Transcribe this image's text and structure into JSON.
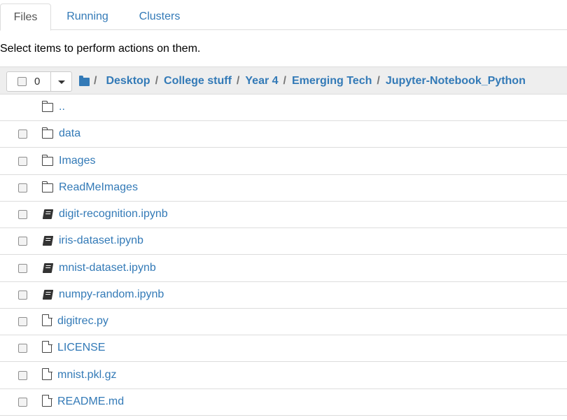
{
  "tabs": {
    "files": "Files",
    "running": "Running",
    "clusters": "Clusters"
  },
  "hint": "Select items to perform actions on them.",
  "toolbar": {
    "selected_count": "0"
  },
  "breadcrumb": {
    "separator": "/",
    "items": [
      "Desktop",
      "College stuff",
      "Year 4",
      "Emerging Tech",
      "Jupyter-Notebook_Python"
    ]
  },
  "files": [
    {
      "name": "..",
      "type": "updir",
      "icon": "folder-icon"
    },
    {
      "name": "data",
      "type": "folder",
      "icon": "folder-icon"
    },
    {
      "name": "Images",
      "type": "folder",
      "icon": "folder-icon"
    },
    {
      "name": "ReadMeImages",
      "type": "folder",
      "icon": "folder-icon"
    },
    {
      "name": " digit-recognition.ipynb",
      "type": "notebook",
      "icon": "notebook-icon"
    },
    {
      "name": "iris-dataset.ipynb",
      "type": "notebook",
      "icon": "notebook-icon"
    },
    {
      "name": "mnist-dataset.ipynb",
      "type": "notebook",
      "icon": "notebook-icon"
    },
    {
      "name": "numpy-random.ipynb",
      "type": "notebook",
      "icon": "notebook-icon"
    },
    {
      "name": "digitrec.py",
      "type": "file",
      "icon": "file-icon"
    },
    {
      "name": "LICENSE",
      "type": "file",
      "icon": "file-icon"
    },
    {
      "name": "mnist.pkl.gz",
      "type": "file",
      "icon": "file-icon"
    },
    {
      "name": "README.md",
      "type": "file",
      "icon": "file-icon"
    }
  ],
  "colors": {
    "link": "#337ab7",
    "header_bg": "#eeeeee",
    "border": "#dddddd"
  }
}
